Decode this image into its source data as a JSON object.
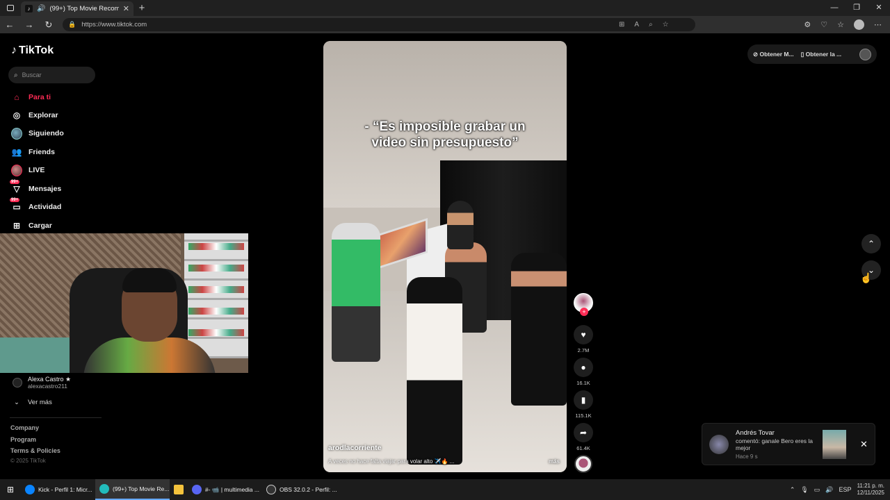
{
  "browser": {
    "tab_title": "(99+) Top Movie Recommend...",
    "url": "https://www.tiktok.com"
  },
  "sidebar": {
    "logo": "TikTok",
    "search_placeholder": "Buscar",
    "menu": [
      {
        "label": "Para ti",
        "icon": "home-icon"
      },
      {
        "label": "Explorar",
        "icon": "compass-icon"
      },
      {
        "label": "Siguiendo",
        "icon": "following-avatar-icon"
      },
      {
        "label": "Friends",
        "icon": "friends-icon"
      },
      {
        "label": "LIVE",
        "icon": "live-avatar-icon"
      },
      {
        "label": "Mensajes",
        "icon": "messages-icon",
        "badge": "99+"
      },
      {
        "label": "Actividad",
        "icon": "activity-icon",
        "badge": "99+"
      },
      {
        "label": "Cargar",
        "icon": "upload-icon"
      }
    ],
    "following_account": {
      "name": "Alexa Castro ★",
      "handle": "alexacastro211"
    },
    "ver_mas": "Ver más",
    "footer": [
      "Company",
      "Program",
      "Terms & Policies"
    ],
    "copyright": "© 2025 TikTok"
  },
  "video": {
    "overlay_text_line1": "- “Es imposible grabar un",
    "overlay_text_line2": "video sin presupuesto”",
    "author": "arodlacorriente",
    "description": "A veces no hace falta viajar para volar alto ✈️🔥 ...",
    "more": "más"
  },
  "actions": {
    "likes": "2.7M",
    "comments": "16.1K",
    "saves": "115.1K",
    "shares": "61.4K"
  },
  "topright": {
    "btn1": "Obtener M...",
    "btn2": "Obtener la ..."
  },
  "notification": {
    "name": "Andrés Tovar",
    "text": "comentó: ganale Bero eres la mejor",
    "time": "Hace 9 s"
  },
  "taskbar": {
    "items": [
      "Kick - Perfil 1: Micr...",
      "(99+) Top Movie Re...",
      "",
      "#- 📹 | multimedia ...",
      "OBS 32.0.2 - Perfil: ..."
    ],
    "lang": "ESP",
    "time": "11:21 p. m.",
    "date": "12/11/2025"
  },
  "colors": {
    "accent": "#fe2c55"
  }
}
